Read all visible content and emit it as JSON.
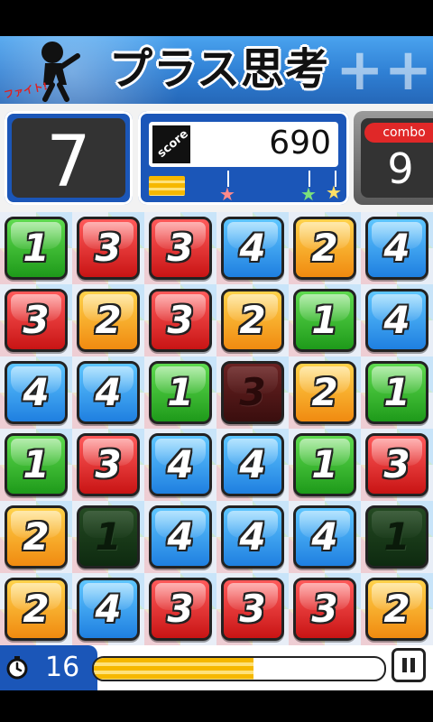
{
  "header": {
    "title": "プラス思考",
    "fight_text": "ファイト!"
  },
  "stats": {
    "moves_left": "7",
    "score_label": "score",
    "score_value": "690",
    "combo_label": "combo",
    "combo_value": "9",
    "stars": [
      {
        "color": "#ff8a8a"
      },
      {
        "color": "#7be07b"
      },
      {
        "color": "#ffe066"
      }
    ]
  },
  "board": {
    "rows": [
      [
        {
          "n": "1",
          "c": "green"
        },
        {
          "n": "3",
          "c": "red"
        },
        {
          "n": "3",
          "c": "red"
        },
        {
          "n": "4",
          "c": "blue"
        },
        {
          "n": "2",
          "c": "orange"
        },
        {
          "n": "4",
          "c": "blue"
        }
      ],
      [
        {
          "n": "3",
          "c": "red"
        },
        {
          "n": "2",
          "c": "orange"
        },
        {
          "n": "3",
          "c": "red"
        },
        {
          "n": "2",
          "c": "orange"
        },
        {
          "n": "1",
          "c": "green"
        },
        {
          "n": "4",
          "c": "blue"
        }
      ],
      [
        {
          "n": "4",
          "c": "blue"
        },
        {
          "n": "4",
          "c": "blue"
        },
        {
          "n": "1",
          "c": "green"
        },
        {
          "n": "3",
          "c": "red",
          "dim": true
        },
        {
          "n": "2",
          "c": "orange"
        },
        {
          "n": "1",
          "c": "green"
        }
      ],
      [
        {
          "n": "1",
          "c": "green"
        },
        {
          "n": "3",
          "c": "red"
        },
        {
          "n": "4",
          "c": "blue"
        },
        {
          "n": "4",
          "c": "blue"
        },
        {
          "n": "1",
          "c": "green"
        },
        {
          "n": "3",
          "c": "red"
        }
      ],
      [
        {
          "n": "2",
          "c": "orange"
        },
        {
          "n": "1",
          "c": "green",
          "dim": true
        },
        {
          "n": "4",
          "c": "blue"
        },
        {
          "n": "4",
          "c": "blue"
        },
        {
          "n": "4",
          "c": "blue"
        },
        {
          "n": "1",
          "c": "green",
          "dim": true
        }
      ],
      [
        {
          "n": "2",
          "c": "orange"
        },
        {
          "n": "4",
          "c": "blue"
        },
        {
          "n": "3",
          "c": "red"
        },
        {
          "n": "3",
          "c": "red"
        },
        {
          "n": "3",
          "c": "red"
        },
        {
          "n": "2",
          "c": "orange"
        }
      ]
    ]
  },
  "footer": {
    "timer_value": "16",
    "progress_fraction": 0.55
  }
}
